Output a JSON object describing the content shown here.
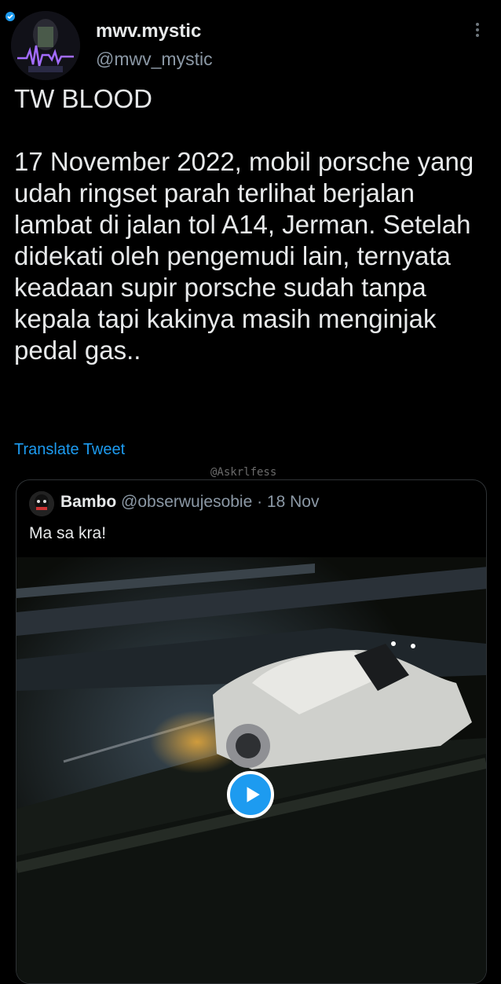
{
  "author": {
    "display_name": "mwv.mystic",
    "handle": "@mwv_mystic"
  },
  "tweet": {
    "text": "TW BLOOD\n\n17 November 2022, mobil porsche yang udah ringset parah terlihat berjalan lambat di jalan tol A14, Jerman. Setelah didekati oleh pengemudi lain, ternyata keadaan supir porsche sudah tanpa kepala tapi kakinya masih menginjak pedal gas..",
    "translate_label": "Translate Tweet"
  },
  "watermark": "@Askrlfess",
  "quoted": {
    "display_name": "Bambo",
    "meta": "@obserwujesobie · 18 Nov",
    "text": "Ma sa kra!"
  },
  "icons": {
    "more": "more-icon",
    "play": "play-icon",
    "verified": "blue-badge-icon"
  },
  "colors": {
    "background": "#000000",
    "text": "#e7e9ea",
    "secondary": "#8b98a5",
    "accent": "#1d9bf0"
  }
}
